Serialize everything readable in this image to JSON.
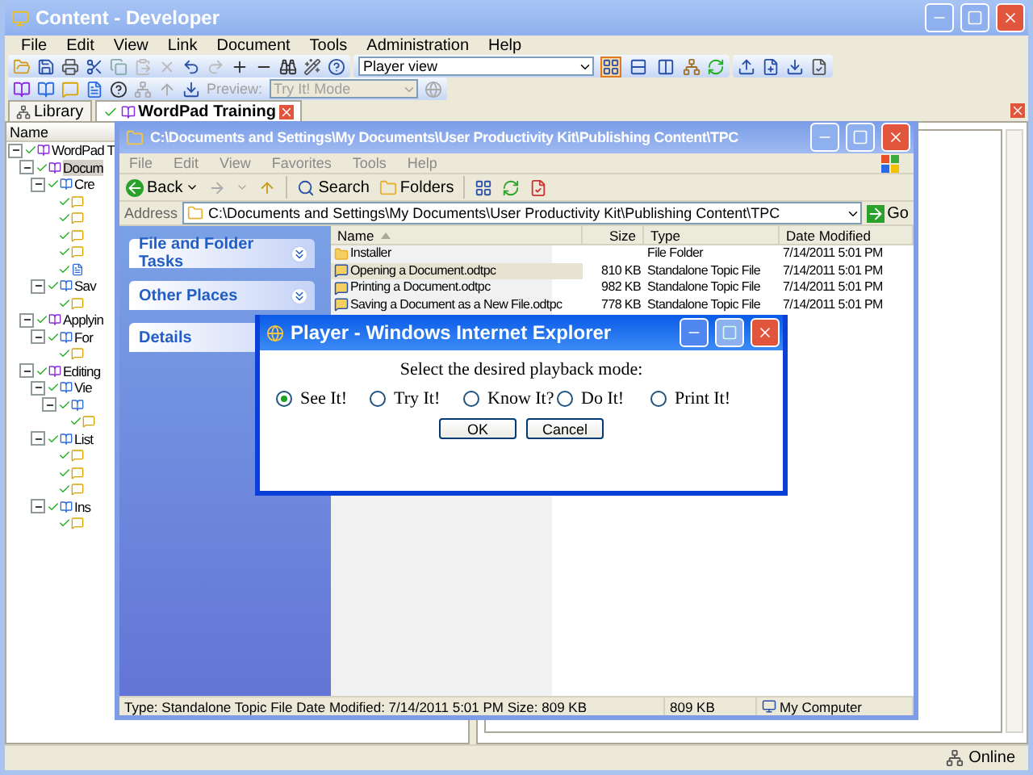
{
  "main_window": {
    "title": "Content - Developer",
    "menu": [
      "File",
      "Edit",
      "View",
      "Link",
      "Document",
      "Tools",
      "Administration",
      "Help"
    ],
    "view_select": {
      "value": "Player view"
    },
    "layout_buttons": [
      {
        "selected": true
      },
      {
        "selected": false
      },
      {
        "selected": false
      }
    ],
    "preview": {
      "label": "Preview:",
      "value": "Try It! Mode",
      "disabled": true
    },
    "tabs": [
      {
        "label": "Library",
        "selected": false
      },
      {
        "label": "WordPad Training",
        "selected": true
      }
    ],
    "tree_header": "Name",
    "tree": [
      {
        "label": "WordPad T",
        "kind": "module",
        "selected": false,
        "expanded": true,
        "children": [
          {
            "label": "Docum",
            "kind": "module",
            "selected": true,
            "expanded": true,
            "children": [
              {
                "label": "Cre",
                "kind": "section",
                "selected": false,
                "expanded": true,
                "children": [
                  {
                    "kind": "topic",
                    "selected": false
                  },
                  {
                    "kind": "topic",
                    "selected": false
                  },
                  {
                    "kind": "topic",
                    "selected": false
                  },
                  {
                    "kind": "topic",
                    "selected": false
                  },
                  {
                    "kind": "page",
                    "selected": false
                  }
                ]
              },
              {
                "label": "Sav",
                "kind": "section",
                "selected": false,
                "expanded": true,
                "children": [
                  {
                    "kind": "topic",
                    "selected": false
                  }
                ]
              }
            ]
          },
          {
            "label": "Applyin",
            "kind": "module",
            "selected": false,
            "expanded": true,
            "children": [
              {
                "label": "For",
                "kind": "section",
                "selected": false,
                "expanded": true,
                "children": [
                  {
                    "kind": "topic",
                    "selected": false
                  }
                ]
              }
            ]
          },
          {
            "label": "Editing",
            "kind": "module",
            "selected": false,
            "expanded": true,
            "children": [
              {
                "label": "Vie",
                "kind": "section",
                "selected": false,
                "expanded": true,
                "children": [
                  {
                    "kind": "section",
                    "selected": false,
                    "expanded": true,
                    "children": [
                      {
                        "kind": "topic",
                        "selected": false
                      }
                    ]
                  }
                ]
              },
              {
                "label": "List",
                "kind": "section",
                "selected": false,
                "expanded": true,
                "children": [
                  {
                    "kind": "topic",
                    "selected": false
                  },
                  {
                    "kind": "topic",
                    "selected": false
                  },
                  {
                    "kind": "topic",
                    "selected": false
                  }
                ]
              },
              {
                "label": "Ins",
                "kind": "section",
                "selected": false,
                "expanded": true,
                "children": [
                  {
                    "kind": "topic",
                    "selected": false
                  }
                ]
              }
            ]
          }
        ]
      }
    ],
    "status": "Online"
  },
  "explorer": {
    "title": "C:\\Documents and Settings\\My Documents\\User Productivity Kit\\Publishing Content\\TPC",
    "menu": [
      "File",
      "Edit",
      "View",
      "Favorites",
      "Tools",
      "Help"
    ],
    "toolbar": {
      "back": "Back",
      "search": "Search",
      "folders": "Folders"
    },
    "address": {
      "label": "Address",
      "value": "C:\\Documents and Settings\\My Documents\\User Productivity Kit\\Publishing Content\\TPC",
      "go": "Go"
    },
    "tasks": [
      {
        "title": "File and Folder Tasks",
        "expanded": false
      },
      {
        "title": "Other Places",
        "expanded": false
      },
      {
        "title": "Details"
      }
    ],
    "columns": [
      "Name",
      "Size",
      "Type",
      "Date Modified"
    ],
    "rows": [
      {
        "kind": "folder",
        "name": "Installer",
        "size": "",
        "type": "File Folder",
        "date": "7/14/2011 5:01 PM",
        "selected": false
      },
      {
        "kind": "topic",
        "name": "Opening a Document.odtpc",
        "size": "810 KB",
        "type": "Standalone Topic File",
        "date": "7/14/2011 5:01 PM",
        "selected": true
      },
      {
        "kind": "topic",
        "name": "Printing a Document.odtpc",
        "size": "982 KB",
        "type": "Standalone Topic File",
        "date": "7/14/2011 5:01 PM",
        "selected": false
      },
      {
        "kind": "topic",
        "name": "Saving a Document as a New File.odtpc",
        "size": "778 KB",
        "type": "Standalone Topic File",
        "date": "7/14/2011 5:01 PM",
        "selected": false
      }
    ],
    "status": [
      "Type: Standalone Topic File Date Modified: 7/14/2011 5:01 PM Size: 809 KB",
      "809 KB",
      "My Computer"
    ]
  },
  "dialog": {
    "title": "Player - Windows Internet Explorer",
    "prompt": "Select the desired playback mode:",
    "modes": [
      {
        "label": "See It!",
        "selected": true
      },
      {
        "label": "Try It!",
        "selected": false
      },
      {
        "label": "Know It?",
        "selected": false
      },
      {
        "label": "Do It!",
        "selected": false
      },
      {
        "label": "Print It!",
        "selected": false
      }
    ],
    "buttons": [
      "OK",
      "Cancel"
    ]
  }
}
